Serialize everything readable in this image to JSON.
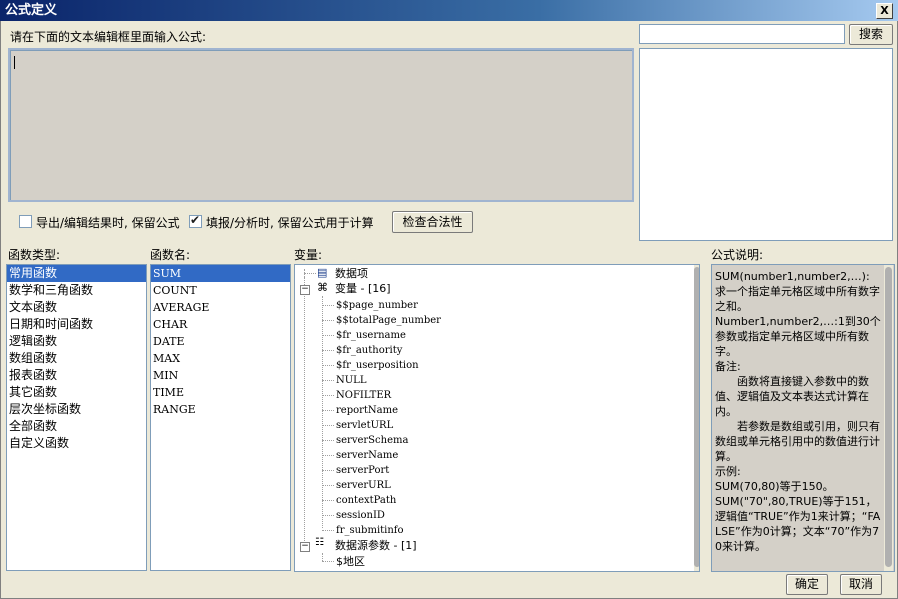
{
  "window": {
    "title": "公式定义",
    "close_label": "X"
  },
  "editor": {
    "prompt": "请在下面的文本编辑框里面输入公式:",
    "value": ""
  },
  "search": {
    "value": "",
    "button_label": "搜索"
  },
  "options": {
    "keep_on_export": {
      "label": "导出/编辑结果时, 保留公式",
      "checked": false
    },
    "keep_on_fill": {
      "label": "填报/分析时, 保留公式用于计算",
      "checked": true
    },
    "check_button": "检查合法性"
  },
  "categories": {
    "header": "函数类型:",
    "items": [
      "常用函数",
      "数学和三角函数",
      "文本函数",
      "日期和时间函数",
      "逻辑函数",
      "数组函数",
      "报表函数",
      "其它函数",
      "层次坐标函数",
      "全部函数",
      "自定义函数"
    ],
    "selected": 0
  },
  "functions": {
    "header": "函数名:",
    "items": [
      "SUM",
      "COUNT",
      "AVERAGE",
      "CHAR",
      "DATE",
      "MAX",
      "MIN",
      "TIME",
      "RANGE"
    ],
    "selected": 0
  },
  "variables": {
    "header": "变量:",
    "dataset_item": "数据项",
    "var_group": "变量 - [16]",
    "var_items": [
      "$$page_number",
      "$$totalPage_number",
      "$fr_username",
      "$fr_authority",
      "$fr_userposition",
      "NULL",
      "NOFILTER",
      "reportName",
      "servletURL",
      "serverSchema",
      "serverName",
      "serverPort",
      "serverURL",
      "contextPath",
      "sessionID",
      "fr_submitinfo"
    ],
    "datasource_group": "数据源参数 - [1]",
    "datasource_items": [
      "$地区"
    ]
  },
  "description": {
    "header": "公式说明:",
    "lines": [
      "SUM(number1,number2,…):",
      "求一个指定单元格区域中所有数字之和。",
      "Number1,number2,…:1到30个参数或指定单元格区域中所有数字。",
      "备注:",
      "　　函数将直接键入参数中的数值、逻辑值及文本表达式计算在内。",
      "　　若参数是数组或引用，则只有数组或单元格引用中的数值进行计算。",
      "示例:",
      "SUM(70,80)等于150。",
      "SUM(\"70\",80,TRUE)等于151，逻辑值“TRUE”作为1来计算；“FALSE”作为0计算；文本“70”作为70来计算。"
    ]
  },
  "footer": {
    "ok_label": "确定",
    "cancel_label": "取消"
  }
}
